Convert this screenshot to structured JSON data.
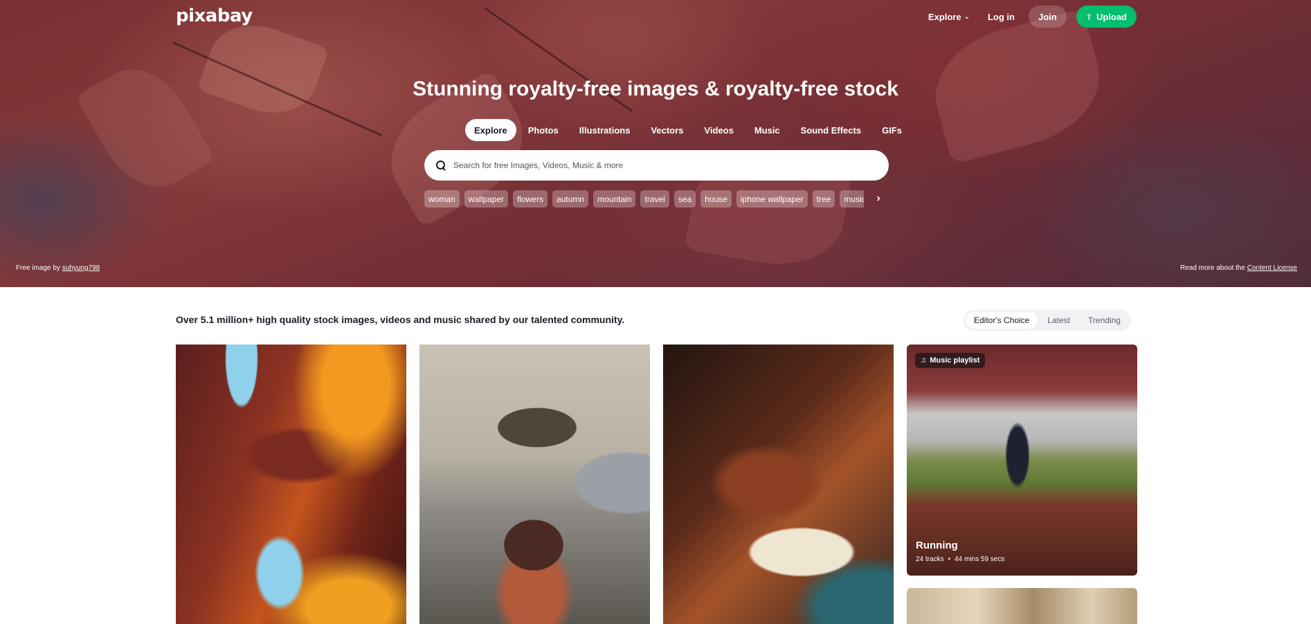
{
  "header": {
    "logo": "pixabay",
    "explore_label": "Explore",
    "login_label": "Log in",
    "join_label": "Join",
    "upload_label": "Upload"
  },
  "hero": {
    "title": "Stunning royalty-free images & royalty-free stock",
    "tabs": [
      "Explore",
      "Photos",
      "Illustrations",
      "Vectors",
      "Videos",
      "Music",
      "Sound Effects",
      "GIFs"
    ],
    "active_tab": "Explore",
    "search_placeholder": "Search for free Images, Videos, Music & more",
    "chips": [
      "woman",
      "wallpaper",
      "flowers",
      "autumn",
      "mountain",
      "travel",
      "sea",
      "house",
      "iphone wallpaper",
      "tree",
      "music"
    ],
    "credit_prefix": "Free image by",
    "credit_user": "suhyung798",
    "license_prefix": "Read more about the",
    "license_link": "Content License"
  },
  "main": {
    "tagline": "Over 5.1 million+ high quality stock images, videos and music shared by our talented community.",
    "sort_options": [
      "Editor's Choice",
      "Latest",
      "Trending"
    ],
    "active_sort": "Editor's Choice",
    "playlist": {
      "badge": "Music playlist",
      "title": "Running",
      "tracks": "24 tracks",
      "duration": "44 mins 59 secs"
    }
  },
  "colors": {
    "accent_green": "#02be6e",
    "text_dark": "#191b26"
  }
}
